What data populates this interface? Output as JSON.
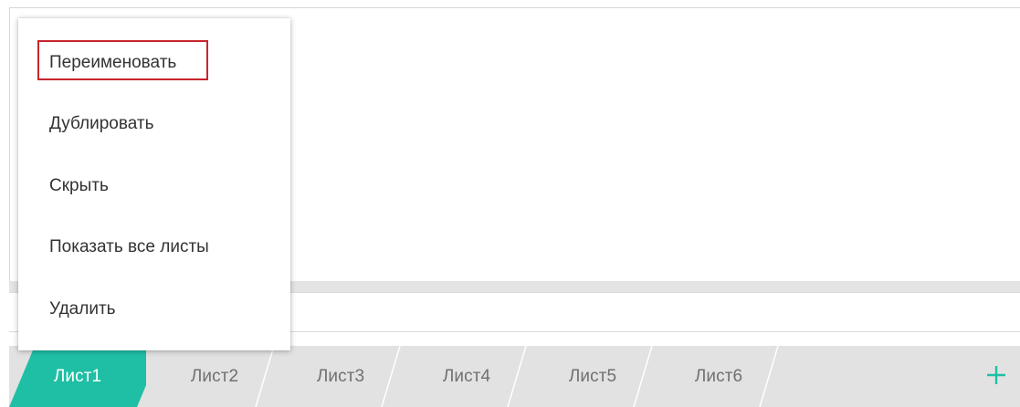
{
  "context_menu": {
    "items": [
      {
        "label": "Переименовать"
      },
      {
        "label": "Дублировать"
      },
      {
        "label": "Скрыть"
      },
      {
        "label": "Показать все листы"
      },
      {
        "label": "Удалить"
      }
    ],
    "highlighted_item": "Переименовать",
    "highlight_color": "#c9252c"
  },
  "sheet_tabs": {
    "tabs": [
      {
        "label": "Лист1",
        "active": true
      },
      {
        "label": "Лист2",
        "active": false
      },
      {
        "label": "Лист3",
        "active": false
      },
      {
        "label": "Лист4",
        "active": false
      },
      {
        "label": "Лист5",
        "active": false
      },
      {
        "label": "Лист6",
        "active": false
      }
    ],
    "add_icon": "plus-icon",
    "active_color": "#1fbfa5",
    "inactive_color": "#e2e2e2"
  }
}
